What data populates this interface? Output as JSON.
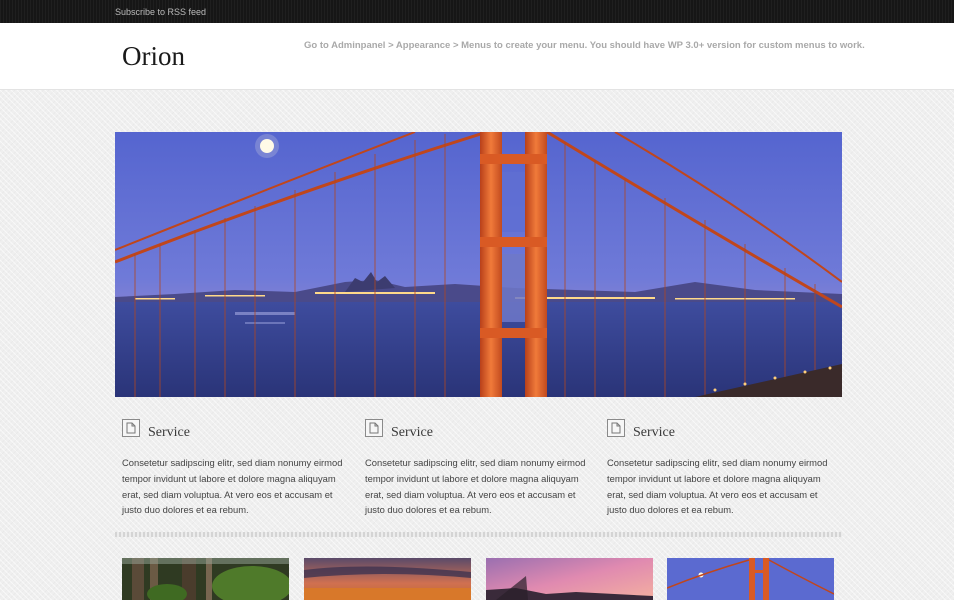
{
  "topbar": {
    "rss_label": "Subscribe to RSS feed"
  },
  "header": {
    "site_title": "Orion",
    "menu_notice": "Go to Adminpanel > Appearance > Menus to create your menu. You should have WP 3.0+ version for custom menus to work."
  },
  "hero": {
    "image": "golden-gate-bridge-night-photo"
  },
  "services": [
    {
      "icon": "document-icon",
      "title": "Service",
      "text": "Consetetur sadipscing elitr, sed diam nonumy eirmod tempor invidunt ut labore et dolore magna aliquyam erat, sed diam voluptua. At vero eos et accusam et justo duo dolores et ea rebum."
    },
    {
      "icon": "document-icon",
      "title": "Service",
      "text": "Consetetur sadipscing elitr, sed diam nonumy eirmod tempor invidunt ut labore et dolore magna aliquyam erat, sed diam voluptua. At vero eos et accusam et justo duo dolores et ea rebum."
    },
    {
      "icon": "document-icon",
      "title": "Service",
      "text": "Consetetur sadipscing elitr, sed diam nonumy eirmod tempor invidunt ut labore et dolore magna aliquyam erat, sed diam voluptua. At vero eos et accusam et justo duo dolores et ea rebum."
    }
  ],
  "thumbnails": [
    {
      "image": "forest-photo"
    },
    {
      "image": "sunset-field-photo"
    },
    {
      "image": "pink-sky-photo"
    },
    {
      "image": "bridge-photo"
    }
  ],
  "colors": {
    "topbar_bg": "#161616",
    "header_bg": "#ffffff",
    "page_bg": "#efefef",
    "notice_text": "#a9a9a9",
    "bridge_orange": "#d94f1f",
    "sky_blue": "#5a6fd0"
  }
}
